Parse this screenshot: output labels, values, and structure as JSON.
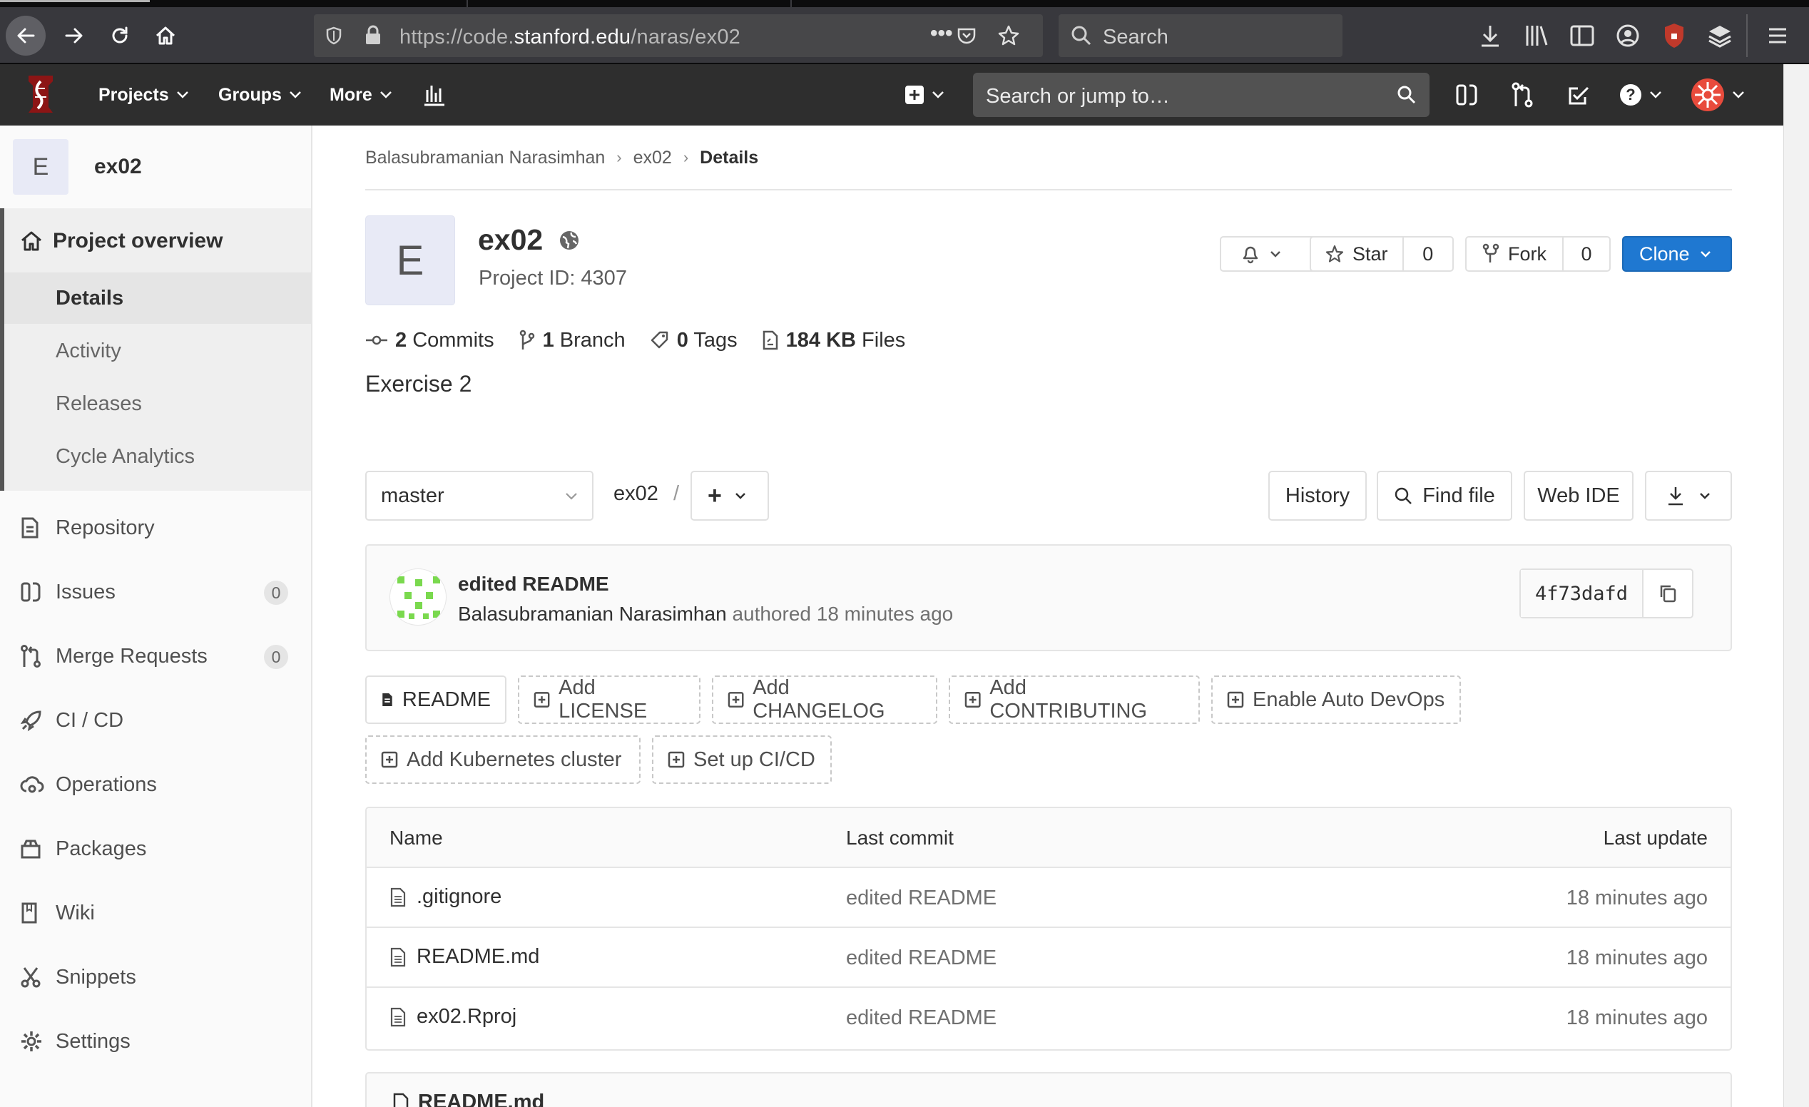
{
  "browser": {
    "url_prefix": "https://code.",
    "url_host": "stanford.edu",
    "url_path": "/naras/ex02",
    "search_placeholder": "Search"
  },
  "header": {
    "nav": [
      {
        "label": "Projects"
      },
      {
        "label": "Groups"
      },
      {
        "label": "More"
      }
    ],
    "search_placeholder": "Search or jump to…"
  },
  "sidebar": {
    "project_initial": "E",
    "project_name": "ex02",
    "overview_label": "Project overview",
    "overview_items": [
      {
        "label": "Details"
      },
      {
        "label": "Activity"
      },
      {
        "label": "Releases"
      },
      {
        "label": "Cycle Analytics"
      }
    ],
    "items": [
      {
        "label": "Repository",
        "icon": "repository-icon"
      },
      {
        "label": "Issues",
        "icon": "issues-icon",
        "badge": "0"
      },
      {
        "label": "Merge Requests",
        "icon": "merge-request-icon",
        "badge": "0"
      },
      {
        "label": "CI / CD",
        "icon": "rocket-icon"
      },
      {
        "label": "Operations",
        "icon": "cloud-gear-icon"
      },
      {
        "label": "Packages",
        "icon": "package-icon"
      },
      {
        "label": "Wiki",
        "icon": "book-icon"
      },
      {
        "label": "Snippets",
        "icon": "scissors-icon"
      },
      {
        "label": "Settings",
        "icon": "gear-icon"
      }
    ]
  },
  "breadcrumb": [
    "Balasubramanian Narasimhan",
    "ex02",
    "Details"
  ],
  "project": {
    "initial": "E",
    "title": "ex02",
    "id_text": "Project ID: 4307",
    "description": "Exercise 2",
    "star_label": "Star",
    "star_count": "0",
    "fork_label": "Fork",
    "fork_count": "0",
    "clone_label": "Clone"
  },
  "stats": [
    {
      "num": "2",
      "label": "Commits",
      "icon": "commit-icon"
    },
    {
      "num": "1",
      "label": "Branch",
      "icon": "branch-icon"
    },
    {
      "num": "0",
      "label": "Tags",
      "icon": "tag-icon"
    },
    {
      "num": "184 KB",
      "label": "Files",
      "icon": "file-icon"
    }
  ],
  "repo_toolbar": {
    "branch": "master",
    "path": "ex02",
    "slash": "/",
    "add": "+",
    "history": "History",
    "find_file": "Find file",
    "web_ide": "Web IDE"
  },
  "last_commit": {
    "title": "edited README",
    "author": "Balasubramanian Narasimhan",
    "meta": "authored 18 minutes ago",
    "sha": "4f73dafd"
  },
  "quick_actions": [
    {
      "label": "README",
      "style": "solid",
      "icon": "document-icon"
    },
    {
      "label": "Add LICENSE",
      "icon": "plus-square-icon"
    },
    {
      "label": "Add CHANGELOG",
      "icon": "plus-square-icon"
    },
    {
      "label": "Add CONTRIBUTING",
      "icon": "plus-square-icon"
    },
    {
      "label": "Enable Auto DevOps",
      "icon": "plus-square-icon"
    },
    {
      "label": "Add Kubernetes cluster",
      "icon": "plus-square-icon"
    },
    {
      "label": "Set up CI/CD",
      "icon": "plus-square-icon"
    }
  ],
  "file_table": {
    "headers": {
      "name": "Name",
      "commit": "Last commit",
      "update": "Last update"
    },
    "rows": [
      {
        "name": ".gitignore",
        "commit": "edited README",
        "update": "18 minutes ago"
      },
      {
        "name": "README.md",
        "commit": "edited README",
        "update": "18 minutes ago"
      },
      {
        "name": "ex02.Rproj",
        "commit": "edited README",
        "update": "18 minutes ago"
      }
    ]
  },
  "readme_title": "README.md",
  "colors": {
    "header_bg": "#2e2e2e",
    "primary": "#1f78d1",
    "stanford_red": "#8c1515"
  }
}
